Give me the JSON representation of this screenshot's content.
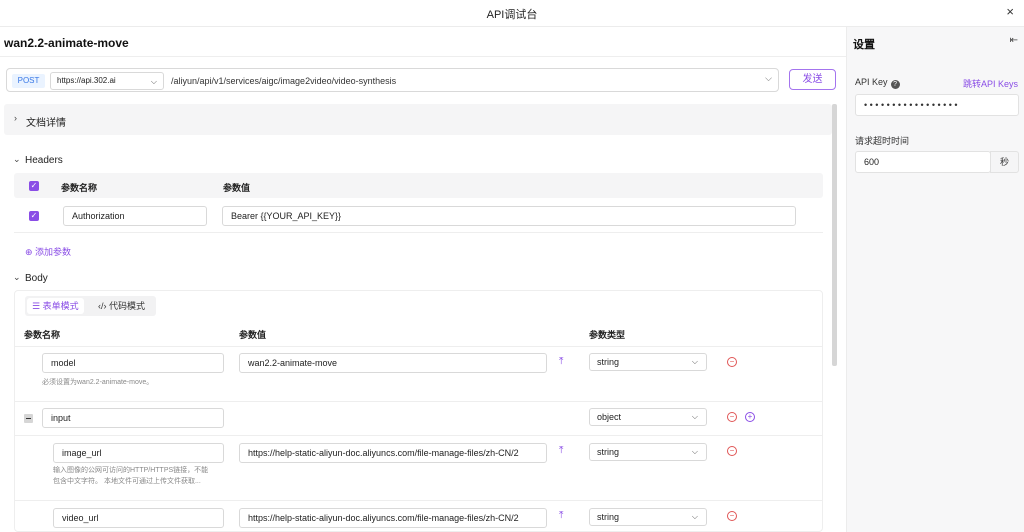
{
  "window": {
    "title": "API调试台",
    "close_glyph": "×"
  },
  "api": {
    "name": "wan2.2-animate-move",
    "method": "POST",
    "host": "https://api.302.ai",
    "path": "/aliyun/api/v1/services/aigc/image2video/video-synthesis",
    "send_label": "发送"
  },
  "doc": {
    "label": "文档详情"
  },
  "headers": {
    "section_label": "Headers",
    "col_name": "参数名称",
    "col_value": "参数值",
    "rows": [
      {
        "name": "Authorization",
        "value": "Bearer {{YOUR_API_KEY}}",
        "checked": true
      }
    ],
    "add_label": "添加参数"
  },
  "body": {
    "section_label": "Body",
    "mode_form": "表单模式",
    "mode_code": "代码模式",
    "col_name": "参数名称",
    "col_value": "参数值",
    "col_type": "参数类型",
    "rows": [
      {
        "name": "model",
        "value": "wan2.2-animate-move",
        "type": "string",
        "hint": "必须设置为wan2.2-animate-move。"
      },
      {
        "name": "input",
        "value": "",
        "type": "object"
      },
      {
        "name": "image_url",
        "value": "https://help-static-aliyun-doc.aliyuncs.com/file-manage-files/zh-CN/2",
        "type": "string",
        "hint_line1": "输入图像的公网可访问的HTTP/HTTPS链接，不能",
        "hint_line2": "包含中文字符。 本地文件可通过上传文件获取..."
      },
      {
        "name": "video_url",
        "value": "https://help-static-aliyun-doc.aliyuncs.com/file-manage-files/zh-CN/2",
        "type": "string"
      }
    ]
  },
  "settings": {
    "title": "设置",
    "api_key_label": "API Key",
    "api_key_link": "跳转API Keys",
    "api_key_value": "• • • • • • • • • • • • • • • • •",
    "timeout_label": "请求超时时间",
    "timeout_value": "600",
    "timeout_unit": "秒"
  },
  "icons": {
    "close": "close-icon",
    "chevron_down": "chevron-down-icon",
    "chevron_right": "chevron-right-icon",
    "upload": "upload-icon",
    "remove": "minus-circle-icon",
    "add": "plus-circle-icon",
    "help": "question-icon",
    "collapse_panel": "collapse-panel-icon"
  },
  "colors": {
    "accent": "#8a4de6",
    "method_bg": "#eaf3ff",
    "method_text": "#3978e6",
    "danger": "#e05555"
  }
}
